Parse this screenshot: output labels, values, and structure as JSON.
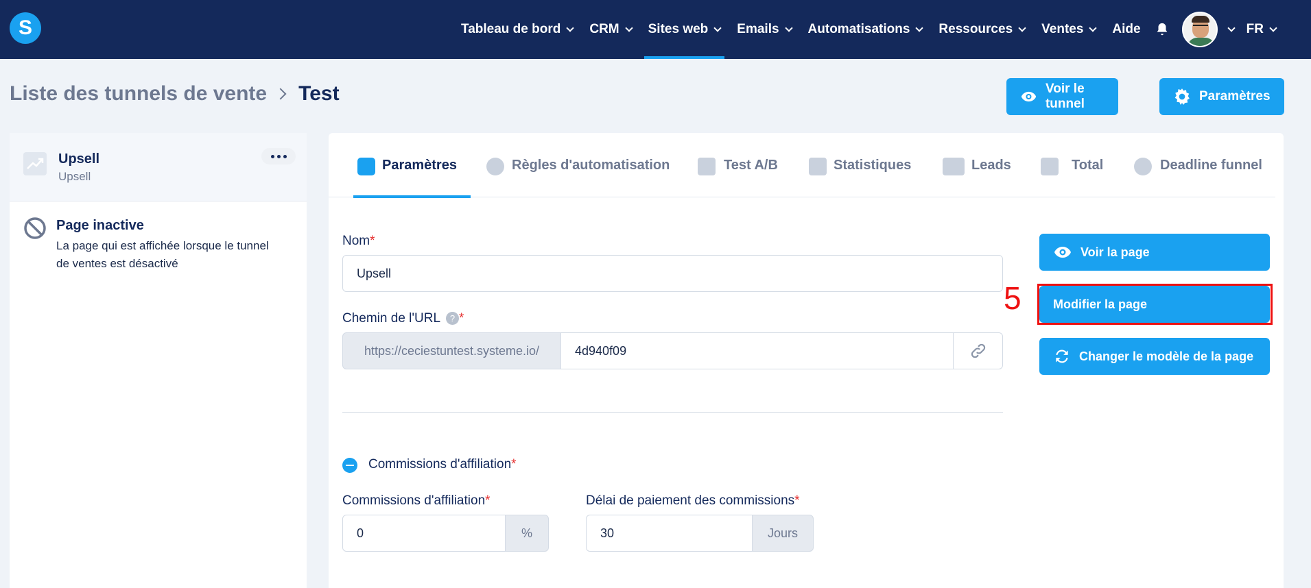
{
  "nav": {
    "items": [
      {
        "label": "Tableau de bord",
        "chevron": true
      },
      {
        "label": "CRM",
        "chevron": true
      },
      {
        "label": "Sites web",
        "chevron": true,
        "active": true
      },
      {
        "label": "Emails",
        "chevron": true
      },
      {
        "label": "Automatisations",
        "chevron": true
      },
      {
        "label": "Ressources",
        "chevron": true
      },
      {
        "label": "Ventes",
        "chevron": true
      },
      {
        "label": "Aide",
        "chevron": false
      }
    ],
    "language": "FR",
    "logo_letter": "S"
  },
  "breadcrumb": {
    "parent": "Liste des tunnels de vente",
    "current": "Test"
  },
  "header_buttons": {
    "voir_tunnel": "Voir le tunnel",
    "parametres": "Paramètres"
  },
  "sidebar": {
    "item_title": "Upsell",
    "item_subtitle": "Upsell",
    "inactive_title": "Page inactive",
    "inactive_desc": "La page qui est affichée lorsque le tunnel de ventes est désactivé"
  },
  "tabs": [
    "Paramètres",
    "Règles d'automatisation",
    "Test A/B",
    "Statistiques",
    "Leads",
    "Total",
    "Deadline funnel"
  ],
  "form": {
    "name_label": "Nom",
    "name_value": "Upsell",
    "url_label": "Chemin de l'URL",
    "url_prefix": "https://ceciestuntest.systeme.io/",
    "url_value": "4d940f09",
    "help": "?",
    "affiliation_section": "Commissions d'affiliation",
    "commission_label": "Commissions d'affiliation",
    "commission_value": "0",
    "commission_unit": "%",
    "delay_label": "Délai de paiement des commissions",
    "delay_value": "30",
    "delay_unit": "Jours",
    "required_mark": "*"
  },
  "actions": {
    "voir_page": "Voir la page",
    "modifier_page": "Modifier la page",
    "changer_modele": "Changer le modèle de la page"
  },
  "annotation": "5"
}
